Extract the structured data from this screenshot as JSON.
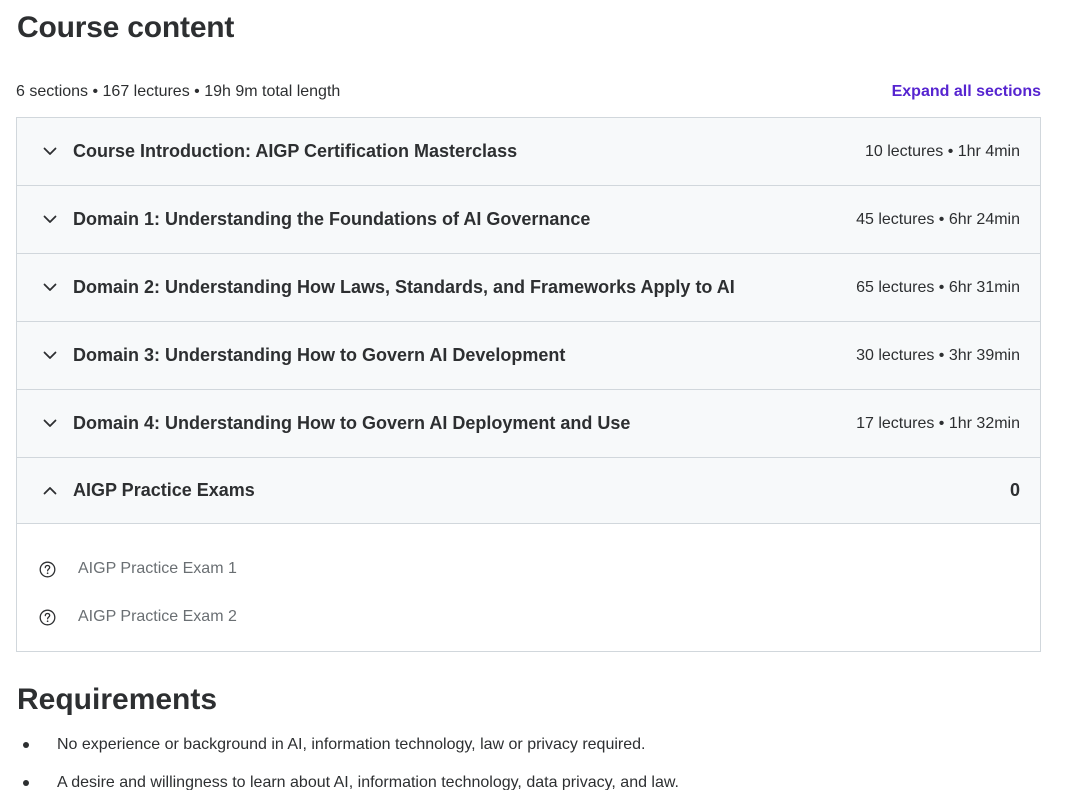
{
  "course_content": {
    "title": "Course content",
    "summary": "6 sections • 167 lectures • 19h 9m total length",
    "expand_label": "Expand all sections",
    "sections": [
      {
        "title": "Course Introduction: AIGP Certification Masterclass",
        "meta": "10 lectures • 1hr 4min",
        "expanded": false
      },
      {
        "title": "Domain 1: Understanding the Foundations of AI Governance",
        "meta": "45 lectures • 6hr 24min",
        "expanded": false
      },
      {
        "title": "Domain 2: Understanding How Laws, Standards, and Frameworks Apply to AI",
        "meta": "65 lectures • 6hr 31min",
        "expanded": false
      },
      {
        "title": "Domain 3: Understanding How to Govern AI Development",
        "meta": "30 lectures • 3hr 39min",
        "expanded": false
      },
      {
        "title": "Domain 4: Understanding How to Govern AI Deployment and Use",
        "meta": "17 lectures • 1hr 32min",
        "expanded": false
      },
      {
        "title": "AIGP Practice Exams",
        "meta": "0",
        "expanded": true,
        "lectures": [
          {
            "title": "AIGP Practice Exam 1",
            "icon": "question-circle-icon"
          },
          {
            "title": "AIGP Practice Exam 2",
            "icon": "question-circle-icon"
          }
        ]
      }
    ]
  },
  "requirements": {
    "title": "Requirements",
    "items": [
      "No experience or background in AI, information technology, law or privacy required.",
      "A desire and willingness to learn about AI, information technology, data privacy, and law."
    ]
  },
  "colors": {
    "text": "#2d2f31",
    "link": "#5624d0",
    "header_bg": "#f7f9fa",
    "border": "#d1d7dc",
    "muted": "#6a6f73"
  }
}
